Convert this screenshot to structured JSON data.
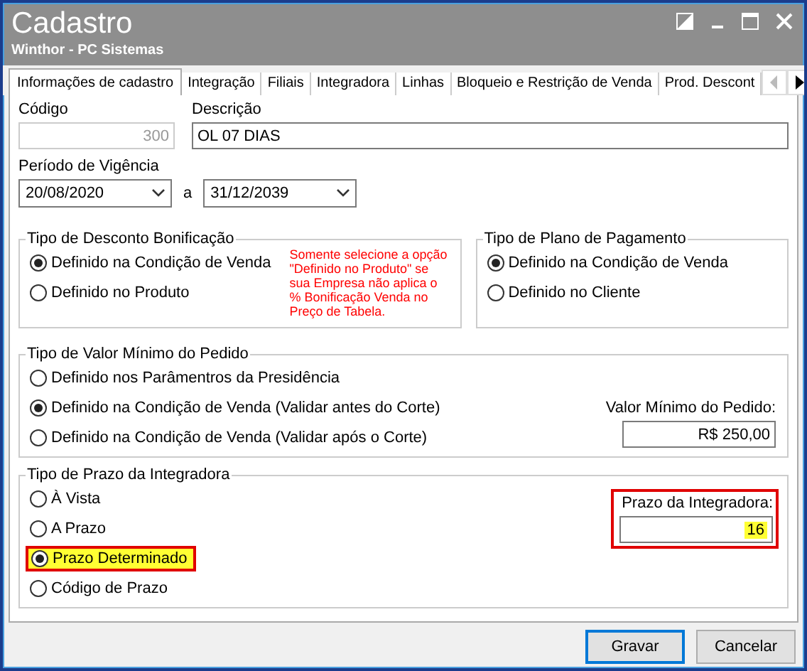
{
  "window": {
    "title": "Cadastro",
    "subtitle": "Winthor - PC Sistemas"
  },
  "tabs": [
    {
      "label": "Informações de cadastro",
      "selected": true
    },
    {
      "label": "Integração",
      "selected": false
    },
    {
      "label": "Filiais",
      "selected": false
    },
    {
      "label": "Integradora",
      "selected": false
    },
    {
      "label": "Linhas",
      "selected": false
    },
    {
      "label": "Bloqueio e Restrição de Venda",
      "selected": false
    },
    {
      "label": "Prod. Descont",
      "selected": false
    }
  ],
  "codigo": {
    "label": "Código",
    "value": "300",
    "disabled": true
  },
  "descricao": {
    "label": "Descrição",
    "value": "OL 07 DIAS"
  },
  "periodo": {
    "label": "Período de Vigência",
    "from": "20/08/2020",
    "separator": "a",
    "to": "31/12/2039"
  },
  "groups": [
    {
      "title": "Tipo de Desconto Bonificação",
      "options": [
        {
          "label": "Definido na Condição de Venda",
          "selected": true,
          "highlighted": false
        },
        {
          "label": "Definido no Produto",
          "selected": false,
          "highlighted": false
        }
      ],
      "note": "Somente selecione a opção \"Definido no Produto\" se sua Empresa não aplica o % Bonificação Venda no Preço de Tabela."
    },
    {
      "title": "Tipo de Plano de Pagamento",
      "options": [
        {
          "label": "Definido na Condição de Venda",
          "selected": true,
          "highlighted": false
        },
        {
          "label": "Definido no Cliente",
          "selected": false,
          "highlighted": false
        }
      ]
    },
    {
      "title": "Tipo de Valor Mínimo do Pedido",
      "options": [
        {
          "label": "Definido nos Parâmentros da Presidência",
          "selected": false,
          "highlighted": false
        },
        {
          "label": "Definido na Condição  de Venda (Validar antes do Corte)",
          "selected": true,
          "highlighted": false
        },
        {
          "label": "Definido na Condição de Venda (Validar após o Corte)",
          "selected": false,
          "highlighted": false
        }
      ],
      "field": {
        "label": "Valor Mínimo do Pedido:",
        "value": "R$ 250,00",
        "highlighted": false
      }
    },
    {
      "title": "Tipo de Prazo da Integradora",
      "options": [
        {
          "label": "À Vista",
          "selected": false,
          "highlighted": false
        },
        {
          "label": "A Prazo",
          "selected": false,
          "highlighted": false
        },
        {
          "label": "Prazo Determinado",
          "selected": true,
          "highlighted": true
        },
        {
          "label": "Código de Prazo",
          "selected": false,
          "highlighted": false
        }
      ],
      "field": {
        "label": "Prazo da Integradora:",
        "value": "16",
        "highlighted": true
      }
    }
  ],
  "buttons": [
    {
      "label": "Gravar",
      "default": true
    },
    {
      "label": "Cancelar",
      "default": false
    }
  ]
}
